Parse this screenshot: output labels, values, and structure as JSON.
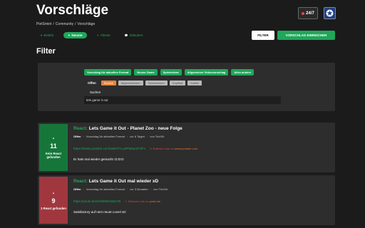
{
  "header": {
    "title": "Vorschläge",
    "breadcrumb": [
      "PietSmiet",
      "/",
      "Community",
      "/",
      "Vorschläge"
    ],
    "live_badge": "24/7"
  },
  "tabs": [
    {
      "label": "Beliebt",
      "icon": "heart-icon",
      "active": false
    },
    {
      "label": "Neuste",
      "icon": "sparkle-icon",
      "active": true
    },
    {
      "label": "Älteste",
      "icon": "sparkle-icon",
      "active": false
    },
    {
      "label": "Diskutiert",
      "icon": "chat-icon",
      "active": false
    }
  ],
  "toolbar": {
    "filter_label": "FILTER",
    "suggest_label": "VORSCHLAG EINREICHEN"
  },
  "filter": {
    "heading": "Filter",
    "categories": [
      "Vorschlag für aktuelles Format",
      "Neues Game",
      "Spieleshow",
      "Allgemeiner Videovorschlag",
      "Alles andere"
    ],
    "status_label": "Offen",
    "statuses": [
      {
        "label": "Review",
        "active": true
      },
      {
        "label": "abgeschlossen",
        "active": false
      },
      {
        "label": "Geschlossen",
        "active": false
      },
      {
        "label": "Duplikat",
        "active": false
      },
      {
        "label": "Inaktiv",
        "active": false
      }
    ],
    "search_label": "Suchen",
    "search_value": "lets game it out"
  },
  "cards": [
    {
      "votes": "11",
      "react_info": "Kein React gefunden",
      "vote_color": "green",
      "tag": "React:",
      "title": "Lets Game it Out - Planet Zoo - neue Folge",
      "status": "Offen",
      "type": "Vorschlag für aktuelles Format",
      "age": "vor 6 Tagen",
      "author": "von TrixX0r",
      "url": "https://www.youtube.com/watch?v=pPPp8uotYZFs",
      "ext_prefix": "Externer Link zu",
      "ext_domain": "www.youtube.com",
      "description": "Er hats mal wieder gemacht :D:D:D"
    },
    {
      "votes": "9",
      "react_info": "1 React gefunden",
      "vote_color": "red",
      "tag": "React:",
      "title": "Lets Game it Out mal wieder xD",
      "status": "Offen",
      "type": "Vorschlag für aktuelles Format",
      "age": "vor 3 Monaten",
      "author": "von TrixX0r",
      "url": "https://youtu.be/wVI5kWL5WU78",
      "ext_prefix": "Externer Link zu",
      "ext_domain": "youtu.be",
      "description": "Satisfactory auf nem neuen Level xD"
    }
  ],
  "colors": {
    "background": "#1b1b1b",
    "panel": "#2d2d2d",
    "accent_green": "#1fa75a",
    "review_orange": "#e8843c",
    "vote_green": "#16763a",
    "vote_red": "#a0373f"
  }
}
